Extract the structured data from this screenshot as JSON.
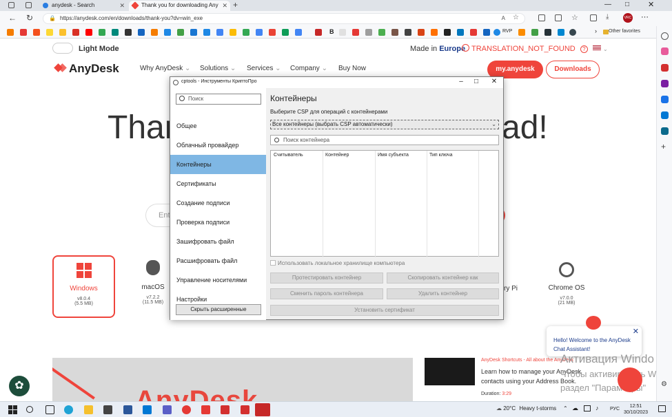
{
  "browser": {
    "tabs": [
      {
        "title": "anydesk - Search",
        "active": false
      },
      {
        "title": "Thank you for downloading Any",
        "active": true
      }
    ],
    "url": "https://anydesk.com/en/downloads/thank-you?dv=win_exe",
    "other_favorites": "Other favorites",
    "profile_initials": "VRC",
    "bookmarks_visible_text": [
      "B",
      "RVP"
    ]
  },
  "page": {
    "light_mode_label": "Light Mode",
    "made_in_prefix": "Made in",
    "made_in_region": "Europe",
    "translation_label": "TRANSLATION_NOT_FOUND",
    "logo_text": "AnyDesk",
    "nav": [
      "Why AnyDesk",
      "Solutions",
      "Services",
      "Company",
      "Buy Now"
    ],
    "my_anydesk_label": "my.anydesk",
    "downloads_label": "Downloads",
    "hero_left": "Than",
    "hero_right": "ad!",
    "search_placeholder": "Ente",
    "os_list": [
      {
        "name": "Windows",
        "version": "v8.0.4",
        "size": "(5.5 MB)",
        "selected": true
      },
      {
        "name": "macOS",
        "version": "v7.2.2",
        "size": "(11.5 MB)",
        "selected": false
      },
      {
        "name": "ry Pi",
        "version": "",
        "size": "",
        "selected": false
      },
      {
        "name": "Chrome OS",
        "version": "v7.0.0",
        "size": "(21 MB)",
        "selected": false
      }
    ],
    "bottom_logo_text": "AnyDesk",
    "video": {
      "title": "AnyDesk Shortcuts - All about the AnyDesk",
      "description": "Learn how to manage your AnyDesk contacts using your Address Book.",
      "duration_label": "Duration:",
      "duration_value": "3:29"
    },
    "chat": {
      "message": "Hello! Welcome to the AnyDesk Chat Assistant!"
    },
    "activation_line1": "Активация Windo",
    "activation_line2": "Чтобы активировать W",
    "activation_line3": "раздел \"Параметры\""
  },
  "dialog": {
    "title": "cptools - Инструменты КриптоПро",
    "search_placeholder": "Поиск",
    "nav": [
      {
        "label": "Общее",
        "selected": false
      },
      {
        "label": "Облачный провайдер",
        "selected": false
      },
      {
        "label": "Контейнеры",
        "selected": true
      },
      {
        "label": "Сертификаты",
        "selected": false
      },
      {
        "label": "Создание подписи",
        "selected": false
      },
      {
        "label": "Проверка подписи",
        "selected": false
      },
      {
        "label": "Зашифровать файл",
        "selected": false
      },
      {
        "label": "Расшифровать файл",
        "selected": false
      },
      {
        "label": "Управление носителями",
        "selected": false
      },
      {
        "label": "Настройки",
        "selected": false
      }
    ],
    "hide_advanced_label": "Скрыть расширенные",
    "heading": "Контейнеры",
    "csp_label": "Выберите CSP для операций с контейнерами",
    "csp_value": "Все контейнеры (выбрать CSP автоматически)",
    "container_search_placeholder": "Поиск контейнера",
    "table_columns": [
      "Считыватель",
      "Контейнер",
      "Имя субъекта",
      "Тип ключа"
    ],
    "table_rows": [],
    "local_storage_label": "Использовать локальное хранилище компьютера",
    "buttons": {
      "test": "Протестировать контейнер",
      "copy": "Скопировать контейнер как",
      "change_password": "Сменить пароль контейнера",
      "delete": "Удалить контейнер",
      "install_cert": "Установить сертификат"
    }
  },
  "taskbar": {
    "weather_temp": "20°C",
    "weather_text": "Heavy t-storms",
    "language": "РУС",
    "time": "12:51",
    "date": "30/10/2023"
  },
  "colors": {
    "brand_red": "#ef443b",
    "selection_blue": "#7fb7e4",
    "europe_blue": "#1b3b8b"
  }
}
